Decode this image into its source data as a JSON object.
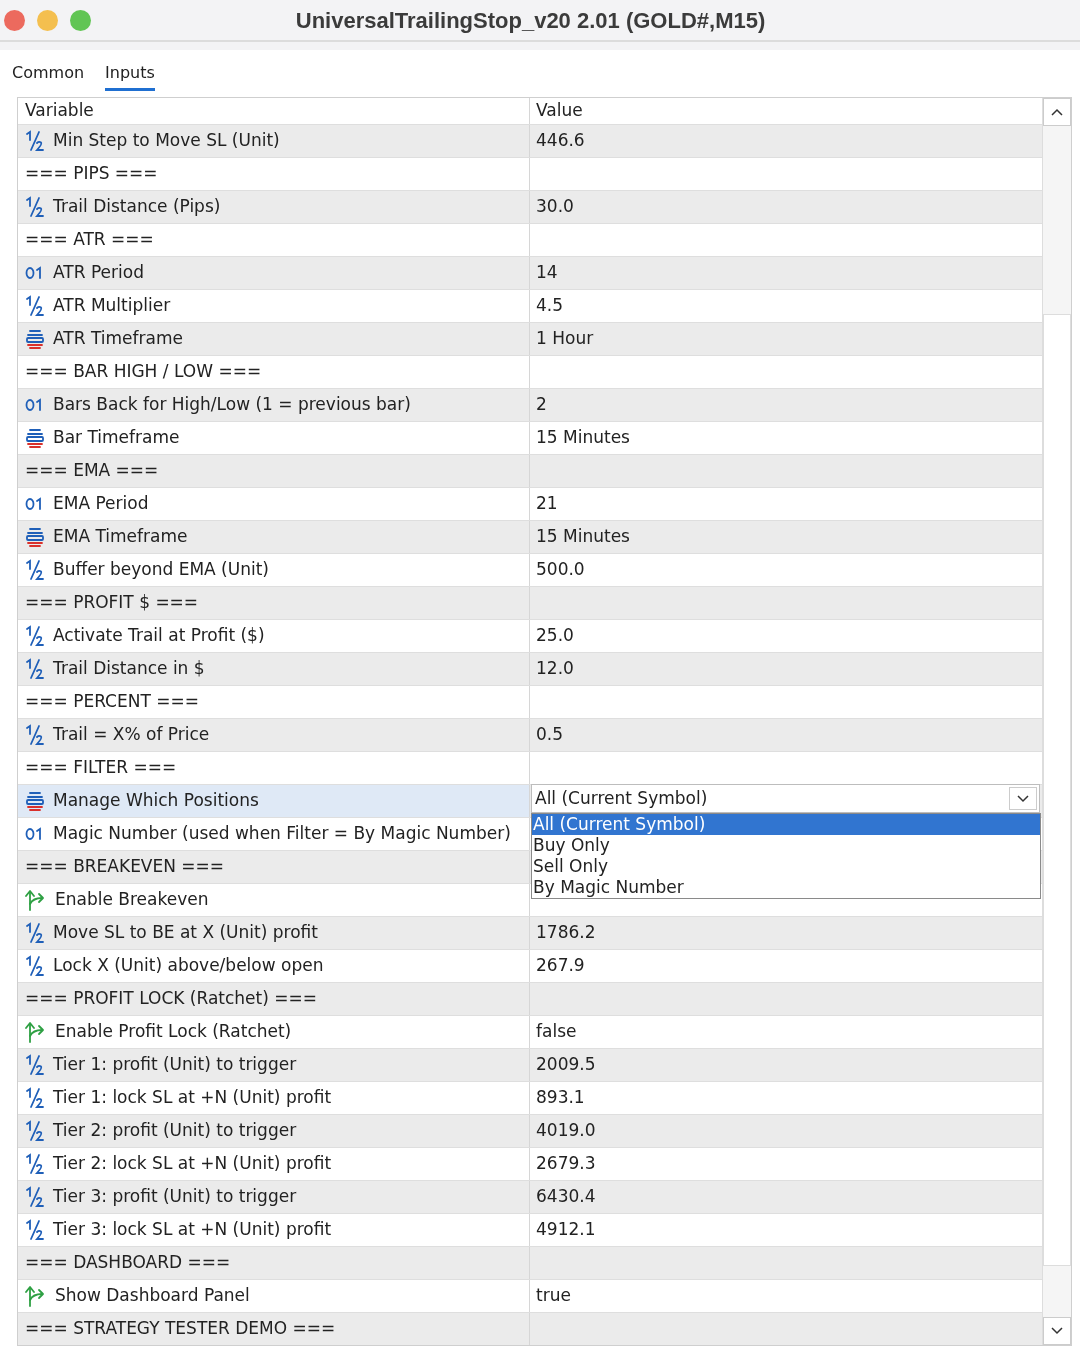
{
  "window": {
    "title": "UniversalTrailingStop_v20 2.01 (GOLD#,M15)"
  },
  "tabs": [
    {
      "label": "Common",
      "selected": false
    },
    {
      "label": "Inputs",
      "selected": true
    }
  ],
  "table": {
    "columns": [
      "Variable",
      "Value"
    ],
    "rows": [
      {
        "kind": "double",
        "variable": "Min Step to Move SL (Unit)",
        "value": "446.6",
        "selected": false
      },
      {
        "kind": "header",
        "variable": "=== PIPS ===",
        "selected": false
      },
      {
        "kind": "double",
        "variable": "Trail Distance (Pips)",
        "value": "30.0",
        "selected": false
      },
      {
        "kind": "header",
        "variable": "=== ATR ===",
        "selected": false
      },
      {
        "kind": "int",
        "variable": "ATR Period",
        "value": "14",
        "selected": false
      },
      {
        "kind": "double",
        "variable": "ATR Multiplier",
        "value": "4.5",
        "selected": false
      },
      {
        "kind": "enum",
        "variable": "ATR Timeframe",
        "value": "1 Hour",
        "selected": false
      },
      {
        "kind": "header",
        "variable": "=== BAR HIGH / LOW ===",
        "selected": false
      },
      {
        "kind": "int",
        "variable": "Bars Back for High/Low (1 = previous bar)",
        "value": "2",
        "selected": false
      },
      {
        "kind": "enum",
        "variable": "Bar Timeframe",
        "value": "15 Minutes",
        "selected": false
      },
      {
        "kind": "header",
        "variable": "=== EMA ===",
        "selected": false
      },
      {
        "kind": "int",
        "variable": "EMA Period",
        "value": "21",
        "selected": false
      },
      {
        "kind": "enum",
        "variable": "EMA Timeframe",
        "value": "15 Minutes",
        "selected": false
      },
      {
        "kind": "double",
        "variable": "Buffer beyond EMA (Unit)",
        "value": "500.0",
        "selected": false
      },
      {
        "kind": "header",
        "variable": "=== PROFIT $ ===",
        "selected": false
      },
      {
        "kind": "double",
        "variable": "Activate Trail at Profit ($)",
        "value": "25.0",
        "selected": false
      },
      {
        "kind": "double",
        "variable": "Trail Distance in $",
        "value": "12.0",
        "selected": false
      },
      {
        "kind": "header",
        "variable": "=== PERCENT ===",
        "selected": false
      },
      {
        "kind": "double",
        "variable": "Trail = X% of Price",
        "value": "0.5",
        "selected": false
      },
      {
        "kind": "header",
        "variable": "=== FILTER ===",
        "selected": false
      },
      {
        "kind": "enum",
        "variable": "Manage Which Positions",
        "selected": true,
        "dropdown": {
          "value": "All (Current Symbol)",
          "options": [
            {
              "label": "All (Current Symbol)",
              "selected": true
            },
            {
              "label": "Buy Only",
              "selected": false
            },
            {
              "label": "Sell Only",
              "selected": false
            },
            {
              "label": "By Magic Number",
              "selected": false
            }
          ]
        }
      },
      {
        "kind": "int",
        "variable": "Magic Number (used when Filter = By Magic Number)",
        "selected": false
      },
      {
        "kind": "header",
        "variable": "=== BREAKEVEN ===",
        "selected": false
      },
      {
        "kind": "bool",
        "variable": "Enable Breakeven",
        "selected": false
      },
      {
        "kind": "double",
        "variable": "Move SL to BE at X (Unit) profit",
        "value": "1786.2",
        "selected": false
      },
      {
        "kind": "double",
        "variable": "Lock X (Unit) above/below open",
        "value": "267.9",
        "selected": false
      },
      {
        "kind": "header",
        "variable": "=== PROFIT LOCK (Ratchet) ===",
        "selected": false
      },
      {
        "kind": "bool",
        "variable": "Enable Profit Lock (Ratchet)",
        "value": "false",
        "selected": false
      },
      {
        "kind": "double",
        "variable": "Tier 1: profit (Unit) to trigger",
        "value": "2009.5",
        "selected": false
      },
      {
        "kind": "double",
        "variable": "Tier 1: lock SL at +N (Unit) profit",
        "value": "893.1",
        "selected": false
      },
      {
        "kind": "double",
        "variable": "Tier 2: profit (Unit) to trigger",
        "value": "4019.0",
        "selected": false
      },
      {
        "kind": "double",
        "variable": "Tier 2: lock SL at +N (Unit) profit",
        "value": "2679.3",
        "selected": false
      },
      {
        "kind": "double",
        "variable": "Tier 3: profit (Unit) to trigger",
        "value": "6430.4",
        "selected": false
      },
      {
        "kind": "double",
        "variable": "Tier 3: lock SL at +N (Unit) profit",
        "value": "4912.1",
        "selected": false
      },
      {
        "kind": "header",
        "variable": "=== DASHBOARD ===",
        "selected": false
      },
      {
        "kind": "bool",
        "variable": "Show Dashboard Panel",
        "value": "true",
        "selected": false
      },
      {
        "kind": "header",
        "variable": "=== STRATEGY TESTER DEMO ===",
        "selected": false
      }
    ]
  }
}
